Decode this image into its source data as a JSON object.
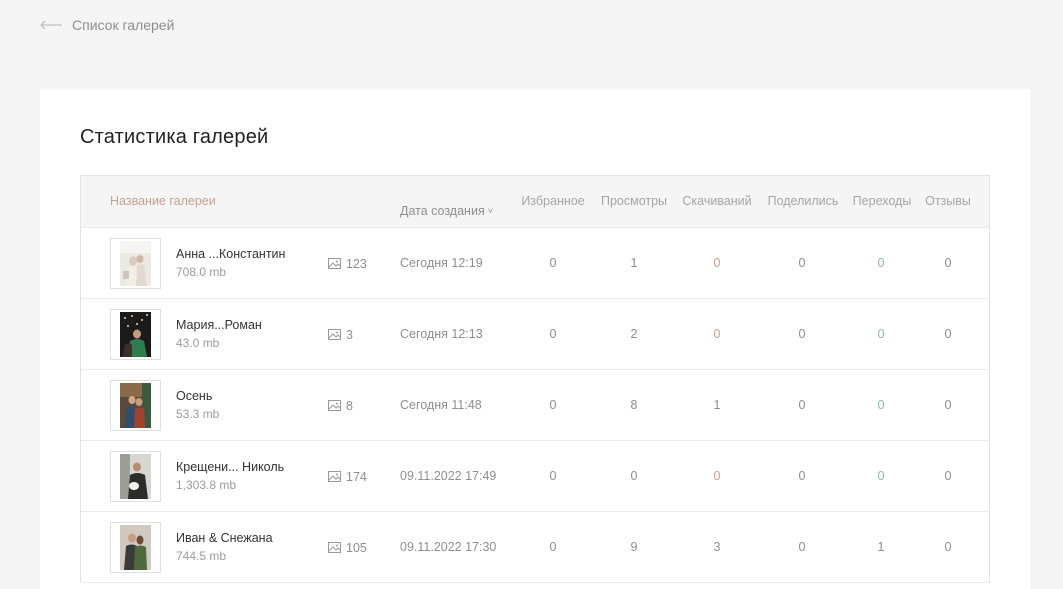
{
  "nav": {
    "back_label": "Список галерей"
  },
  "page": {
    "title": "Статистика галерей"
  },
  "table": {
    "headers": {
      "name": "Название галереи",
      "date": "Дата создания",
      "favorites": "Избранное",
      "views": "Просмотры",
      "downloads": "Скачиваний",
      "shares": "Поделились",
      "transitions": "Переходы",
      "reviews": "Отзывы"
    },
    "sort_caret": "˅",
    "accent_header_color": "#c8a08e",
    "download_zero_color": "#c8a08e",
    "transitions_zero_color": "#8fb9a9",
    "rows": [
      {
        "name": "Анна ...Константин",
        "size": "708.0 mb",
        "photos": "123",
        "date": "Сегодня 12:19",
        "favorites": "0",
        "views": "1",
        "downloads": "0",
        "shares": "0",
        "transitions": "0",
        "reviews": "0"
      },
      {
        "name": "Мария...Роман",
        "size": "43.0 mb",
        "photos": "3",
        "date": "Сегодня 12:13",
        "favorites": "0",
        "views": "2",
        "downloads": "0",
        "shares": "0",
        "transitions": "0",
        "reviews": "0"
      },
      {
        "name": "Осень",
        "size": "53.3 mb",
        "photos": "8",
        "date": "Сегодня 11:48",
        "favorites": "0",
        "views": "8",
        "downloads": "1",
        "shares": "0",
        "transitions": "0",
        "reviews": "0"
      },
      {
        "name": "Крещени... Николь",
        "size": "1,303.8 mb",
        "photos": "174",
        "date": "09.11.2022 17:49",
        "favorites": "0",
        "views": "0",
        "downloads": "0",
        "shares": "0",
        "transitions": "0",
        "reviews": "0"
      },
      {
        "name": "Иван & Снежана",
        "size": "744.5 mb",
        "photos": "105",
        "date": "09.11.2022 17:30",
        "favorites": "0",
        "views": "9",
        "downloads": "3",
        "shares": "0",
        "transitions": "1",
        "reviews": "0"
      }
    ]
  }
}
